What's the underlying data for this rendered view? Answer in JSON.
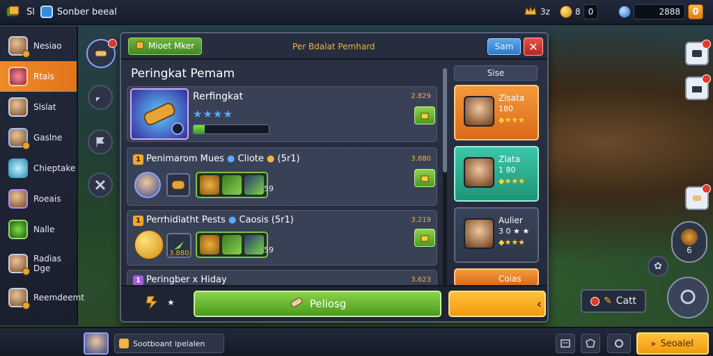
{
  "topbar": {
    "left_text": "Sl",
    "title": "Sonber beeal",
    "res1_text": "3z",
    "res2_text": "8",
    "res2_box": "0",
    "gem_value": "2888",
    "gem_box": "0"
  },
  "sidebar": {
    "items": [
      {
        "label": "Nesiao"
      },
      {
        "label": "Rtais"
      },
      {
        "label": "Slslat"
      },
      {
        "label": "Gaslne"
      },
      {
        "label": "Chieptake"
      },
      {
        "label": "Roeais"
      },
      {
        "label": "Nalle"
      },
      {
        "label": "Radias Dge"
      },
      {
        "label": "Reemdeemt"
      }
    ]
  },
  "panel": {
    "tab_label": "Mioet Mker",
    "header_title": "Per Bdalat Pemhard",
    "blue_btn": "Sam",
    "close_symbol": "✕",
    "subtitle": "Peringkat Pemam",
    "cards": [
      {
        "title": "Rerfingkat",
        "number": "2.829",
        "stars": "★★★★",
        "progress": 0.15
      },
      {
        "badge": "1",
        "title": "Penimarom Mues",
        "extra": "Cliote",
        "paren": "(5r1)",
        "number": "3.880",
        "count": "59"
      },
      {
        "badge": "1",
        "title": "Perrhidlatht Pests",
        "extra": "Caosis",
        "paren": "(5r1)",
        "number": "3.219",
        "slot_value": "3.880",
        "count": "59"
      },
      {
        "badge": "1",
        "title": "Peringber x Hiday",
        "number": "3.623"
      }
    ]
  },
  "right_col": {
    "header": "Sise",
    "heroes": [
      {
        "name": "Zlsata",
        "level": "180",
        "stars": "◆★★★"
      },
      {
        "name": "Zlata",
        "level": "1 80",
        "stars": "◆★★★"
      },
      {
        "name": "Aulier",
        "level": "3 0  ★ ★",
        "stars": "◆★★★"
      },
      {
        "name": "Coias",
        "level": "",
        "stars": ""
      }
    ]
  },
  "action": {
    "sub_label": "★",
    "main_label": "Peliosg"
  },
  "right_edge": {
    "catch_label": "Catt",
    "badge_6": "6"
  },
  "bottombar": {
    "text": "Sootboant ipelalen",
    "orange_label": "Seoalel"
  }
}
